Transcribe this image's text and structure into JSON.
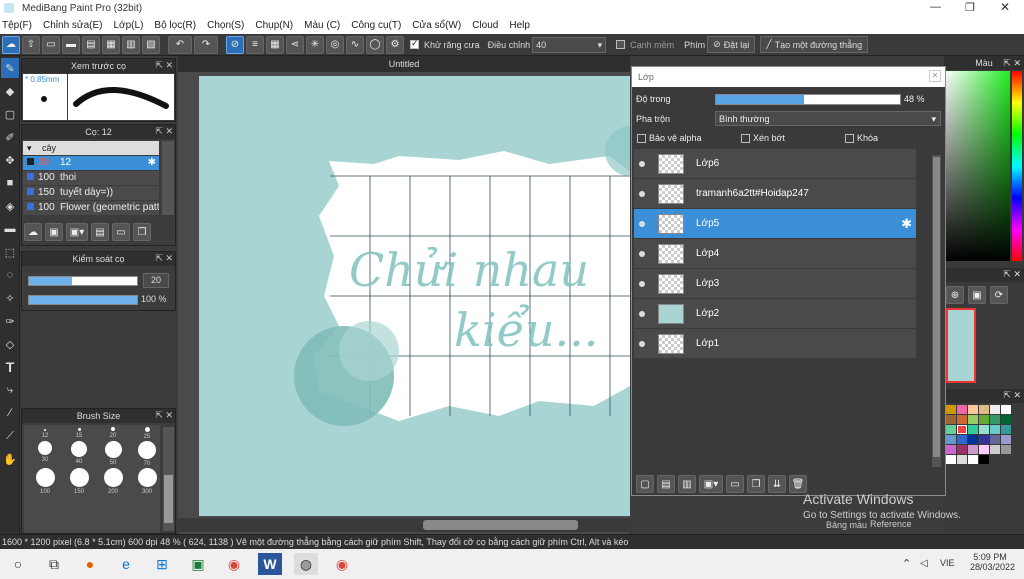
{
  "window": {
    "title": "MediBang Paint Pro (32bit)"
  },
  "menu": [
    "Tệp(F)",
    "Chỉnh sửa(E)",
    "Lớp(L)",
    "Bộ lọc(R)",
    "Chọn(S)",
    "Chụp(N)",
    "Màu (C)",
    "Công cụ(T)",
    "Cửa sổ(W)",
    "Cloud",
    "Help"
  ],
  "toolbar": {
    "antialias_label": "Khử răng cưa",
    "adjust_label": "Điều chỉnh",
    "adjust_value": "40",
    "smooth_label": "Cạnh mềm",
    "key_label": "Phím",
    "reset_label": "Đặt lại",
    "line_label": "Tạo một đường thẳng"
  },
  "preview": {
    "title": "Xem trước cọ",
    "size": "0.85mm"
  },
  "brush": {
    "title": "Cọ: 12",
    "group": "cây",
    "items": [
      {
        "size": "20",
        "value": "12",
        "name": "12"
      },
      {
        "size": "100",
        "name": "thoi"
      },
      {
        "size": "150",
        "name": "tuyết dày=))"
      },
      {
        "size": "100",
        "name": "Flower (geometric patt"
      }
    ]
  },
  "control": {
    "title": "Kiểm soát cọ",
    "size_value": "20",
    "opacity_value": "100 %"
  },
  "brushsize": {
    "title": "Brush Size",
    "labels": [
      "12",
      "15",
      "20",
      "25",
      "30",
      "40",
      "50",
      "70",
      "100",
      "150",
      "200",
      "300"
    ]
  },
  "canvas": {
    "title": "Untitled",
    "art_text_1": "Chửi nhau",
    "art_text_2": "kiểu..."
  },
  "layers": {
    "title": "Lớp",
    "opacity_label": "Độ trong",
    "opacity_value": "48 %",
    "opacity_fraction": 0.48,
    "blend_label": "Pha trộn",
    "blend_value": "Bình thường",
    "protect_alpha": "Bảo vệ alpha",
    "clip": "Xén bớt",
    "lock": "Khóa",
    "items": [
      {
        "name": "Lớp6"
      },
      {
        "name": "tramanh6a2tt#Hoidap247"
      },
      {
        "name": "Lớp5",
        "selected": true
      },
      {
        "name": "Lớp4"
      },
      {
        "name": "Lớp3"
      },
      {
        "name": "Lớp2"
      },
      {
        "name": "Lớp1"
      }
    ]
  },
  "right": {
    "header": "Màu",
    "tab1": "Bảng màu",
    "tab2": "Reference"
  },
  "status": {
    "text": "1600 * 1200 pixel  (6.8 * 5.1cm)  600 dpi  48 %  ( 624, 1138 )  Vẽ một đường thẳng bằng cách giữ phím Shift, Thay đổi cỡ cọ bằng cách giữ phím Ctrl, Alt và kéo"
  },
  "watermark": {
    "line1": "Activate Windows",
    "line2": "Go to Settings to activate Windows."
  },
  "taskbar": {
    "lang": "VIE",
    "time": "5:09 PM",
    "date": "28/03/2022"
  },
  "colors": {
    "accent": "#3b8fd7",
    "canvas_bg": "#a8d4d4",
    "art": "#7fc1be"
  }
}
